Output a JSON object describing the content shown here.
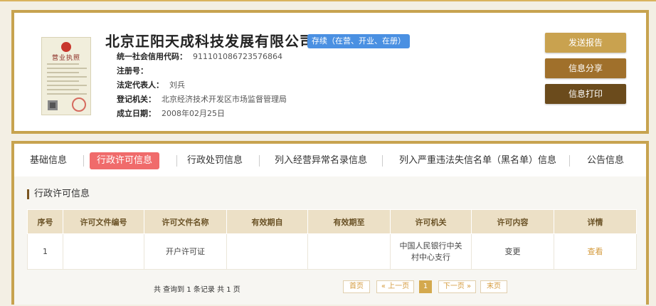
{
  "company": {
    "name": "北京正阳天成科技发展有限公司",
    "status": "存续（在营、开业、在册）",
    "license_title": "营业执照",
    "fields": [
      {
        "label": "统一社会信用代码：",
        "value": "911101086723576864"
      },
      {
        "label": "注册号：",
        "value": ""
      },
      {
        "label": "法定代表人：",
        "value": "刘兵"
      },
      {
        "label": "登记机关：",
        "value": "北京经济技术开发区市场监督管理局"
      },
      {
        "label": "成立日期：",
        "value": "2008年02月25日"
      }
    ]
  },
  "actions": {
    "send_report": "发送报告",
    "share": "信息分享",
    "print": "信息打印"
  },
  "colors": {
    "border": "#c7a34f",
    "send_report_bg": "#c9a24f",
    "share_bg": "#a0702b",
    "print_bg": "#6b4b1c",
    "active_tab": "#f06b6b",
    "status_badge": "#4a90e2"
  },
  "tabs": [
    {
      "label": "基础信息",
      "active": false
    },
    {
      "label": "行政许可信息",
      "active": true
    },
    {
      "label": "行政处罚信息",
      "active": false
    },
    {
      "label": "列入经营异常名录信息",
      "active": false
    },
    {
      "label": "列入严重违法失信名单（黑名单）信息",
      "active": false
    },
    {
      "label": "公告信息",
      "active": false
    }
  ],
  "section": {
    "title": "行政许可信息",
    "columns": [
      "序号",
      "许可文件编号",
      "许可文件名称",
      "有效期自",
      "有效期至",
      "许可机关",
      "许可内容",
      "详情"
    ],
    "rows": [
      {
        "index": "1",
        "doc_no": "",
        "doc_name": "开户许可证",
        "valid_from": "",
        "valid_to": "",
        "authority": "中国人民银行中关村中心支行",
        "content": "变更",
        "detail": "查看"
      }
    ]
  },
  "pagination": {
    "summary": "共 查询到 1 条记录 共 1 页",
    "first": "首页",
    "prev": "« 上一页",
    "current": "1",
    "next": "下一页 »",
    "last": "末页"
  }
}
